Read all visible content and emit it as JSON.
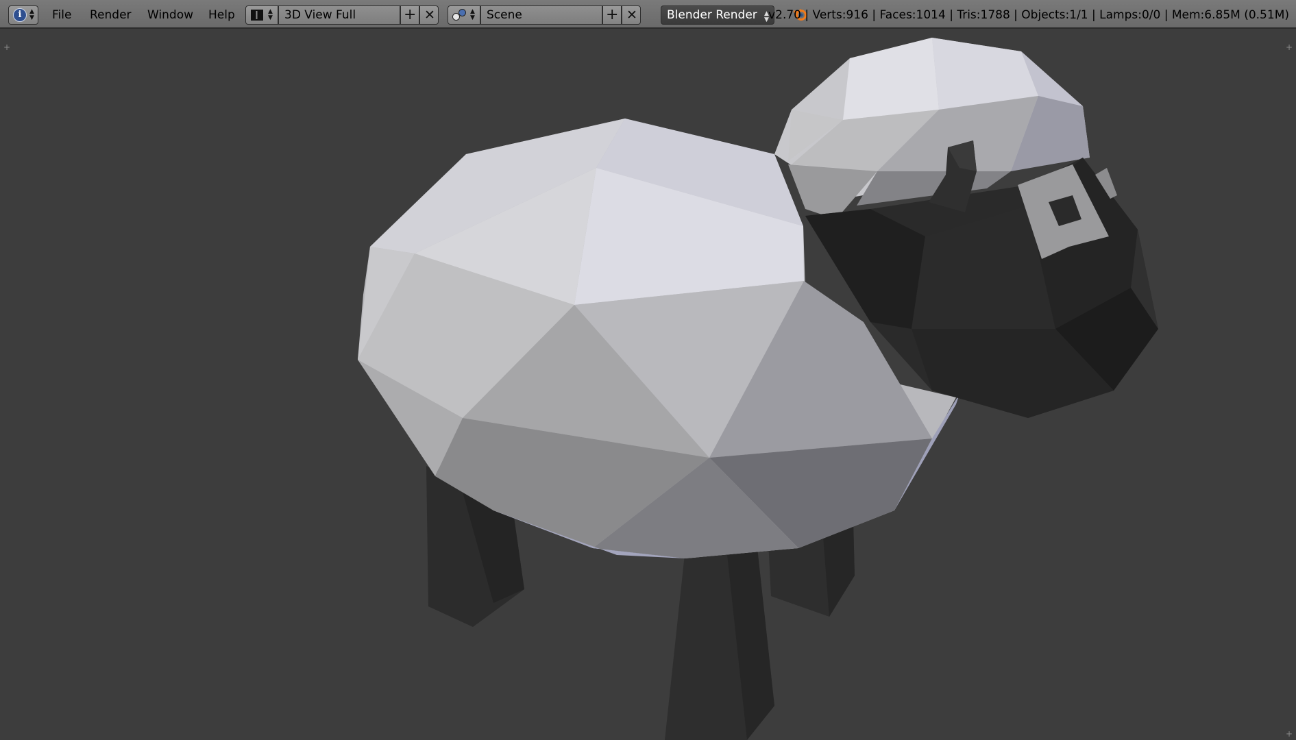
{
  "header": {
    "info_icon": "info-icon",
    "menus": {
      "file": "File",
      "render": "Render",
      "window": "Window",
      "help": "Help"
    },
    "screen_layout": {
      "icon": "screen-layout-icon",
      "value": "3D View Full"
    },
    "scene": {
      "icon": "scene-icon",
      "value": "Scene"
    },
    "render_engine": {
      "value": "Blender Render"
    },
    "blender_logo": "blender-logo-icon",
    "stats": "v2.70 | Verts:916 | Faces:1014 | Tris:1788 | Objects:1/1 | Lamps:0/0 | Mem:6.85M (0.51M)"
  },
  "viewport": {
    "object": "low-poly sheep model",
    "colors": {
      "background": "#3d3d3d",
      "wool_light": "#dcdce6",
      "wool_shadow": "#7d7d80",
      "head": "#2a2a2a",
      "legs": "#2d2d2d"
    }
  }
}
